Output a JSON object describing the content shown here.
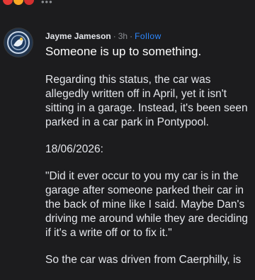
{
  "post": {
    "author": "Jayme Jameson",
    "separator": "·",
    "time": "3h",
    "follow": "Follow",
    "headline": "Someone is up to something.",
    "paragraphs": [
      "Regarding this status, the car was allegedly written off in April, yet it isn't sitting in a garage. Instead, it's been seen parked in a car park in Pontypool.",
      "18/06/2026:",
      "\"Did it ever occur to you my car is in the garage after someone parked their car in the back of mine like I said. Maybe Dan's driving me around while they are deciding if it's a write off or to fix it.\"",
      "So the car was driven from Caerphilly, is"
    ]
  },
  "colors": {
    "background": "#1c1c1e",
    "text": "#e4e6eb",
    "secondary": "#8a8d91",
    "link": "#2d88ff"
  },
  "icons": {
    "reactions": [
      "reaction-angry-icon",
      "reaction-haha-icon",
      "reaction-angry-icon"
    ],
    "more": "more-icon"
  }
}
